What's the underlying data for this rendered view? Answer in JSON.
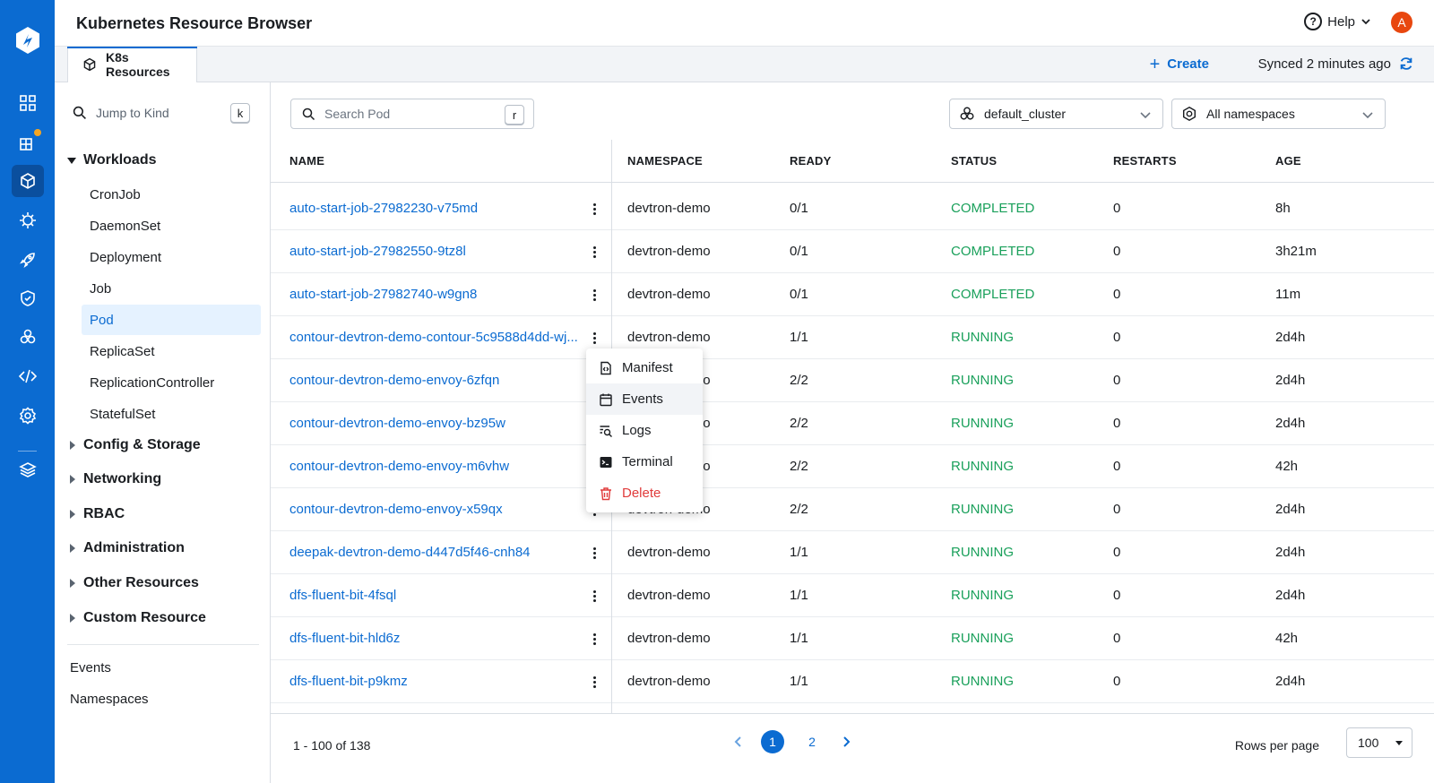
{
  "header": {
    "title": "Kubernetes Resource Browser",
    "help_label": "Help",
    "avatar_initial": "A"
  },
  "tabbar": {
    "tab_label": "K8s Resources",
    "create_label": "Create",
    "synced_text": "Synced 2 minutes ago"
  },
  "sidebar": {
    "jump_placeholder": "Jump to Kind",
    "jump_shortcut": "k",
    "workloads_label": "Workloads",
    "workloads": [
      "CronJob",
      "DaemonSet",
      "Deployment",
      "Job",
      "Pod",
      "ReplicaSet",
      "ReplicationController",
      "StatefulSet"
    ],
    "active_kind": "Pod",
    "groups": [
      "Config & Storage",
      "Networking",
      "RBAC",
      "Administration",
      "Other Resources",
      "Custom Resource"
    ],
    "links": [
      "Events",
      "Namespaces"
    ]
  },
  "main": {
    "search_placeholder": "Search Pod",
    "search_shortcut": "r",
    "cluster": "default_cluster",
    "namespace": "All namespaces",
    "columns": [
      "NAME",
      "NAMESPACE",
      "READY",
      "STATUS",
      "RESTARTS",
      "AGE"
    ],
    "rows": [
      {
        "name": "auto-start-job-27982230-v75md",
        "namespace": "devtron-demo",
        "ready": "0/1",
        "status": "COMPLETED",
        "restarts": "0",
        "age": "8h"
      },
      {
        "name": "auto-start-job-27982550-9tz8l",
        "namespace": "devtron-demo",
        "ready": "0/1",
        "status": "COMPLETED",
        "restarts": "0",
        "age": "3h21m"
      },
      {
        "name": "auto-start-job-27982740-w9gn8",
        "namespace": "devtron-demo",
        "ready": "0/1",
        "status": "COMPLETED",
        "restarts": "0",
        "age": "11m"
      },
      {
        "name": "contour-devtron-demo-contour-5c9588d4dd-wj...",
        "namespace": "devtron-demo",
        "ready": "1/1",
        "status": "RUNNING",
        "restarts": "0",
        "age": "2d4h"
      },
      {
        "name": "contour-devtron-demo-envoy-6zfqn",
        "namespace": "devtron-demo",
        "ready": "2/2",
        "status": "RUNNING",
        "restarts": "0",
        "age": "2d4h"
      },
      {
        "name": "contour-devtron-demo-envoy-bz95w",
        "namespace": "devtron-demo",
        "ready": "2/2",
        "status": "RUNNING",
        "restarts": "0",
        "age": "2d4h"
      },
      {
        "name": "contour-devtron-demo-envoy-m6vhw",
        "namespace": "devtron-demo",
        "ready": "2/2",
        "status": "RUNNING",
        "restarts": "0",
        "age": "42h"
      },
      {
        "name": "contour-devtron-demo-envoy-x59qx",
        "namespace": "devtron-demo",
        "ready": "2/2",
        "status": "RUNNING",
        "restarts": "0",
        "age": "2d4h"
      },
      {
        "name": "deepak-devtron-demo-d447d5f46-cnh84",
        "namespace": "devtron-demo",
        "ready": "1/1",
        "status": "RUNNING",
        "restarts": "0",
        "age": "2d4h"
      },
      {
        "name": "dfs-fluent-bit-4fsql",
        "namespace": "devtron-demo",
        "ready": "1/1",
        "status": "RUNNING",
        "restarts": "0",
        "age": "2d4h"
      },
      {
        "name": "dfs-fluent-bit-hld6z",
        "namespace": "devtron-demo",
        "ready": "1/1",
        "status": "RUNNING",
        "restarts": "0",
        "age": "42h"
      },
      {
        "name": "dfs-fluent-bit-p9kmz",
        "namespace": "devtron-demo",
        "ready": "1/1",
        "status": "RUNNING",
        "restarts": "0",
        "age": "2d4h"
      }
    ]
  },
  "context_menu": {
    "items": [
      {
        "label": "Manifest",
        "icon": "manifest-icon"
      },
      {
        "label": "Events",
        "icon": "calendar-icon"
      },
      {
        "label": "Logs",
        "icon": "logs-icon"
      },
      {
        "label": "Terminal",
        "icon": "terminal-icon"
      },
      {
        "label": "Delete",
        "icon": "trash-icon"
      }
    ]
  },
  "footer": {
    "range_text": "1 - 100 of 138",
    "pages": [
      "1",
      "2"
    ],
    "current_page": "1",
    "rows_per_page_label": "Rows per page",
    "rows_per_page_value": "100"
  },
  "colors": {
    "brand": "#0b6bd1",
    "status_green": "#1aa05b",
    "danger": "#e03b3b",
    "notification_dot": "#f5a623",
    "avatar": "#e8470f"
  }
}
